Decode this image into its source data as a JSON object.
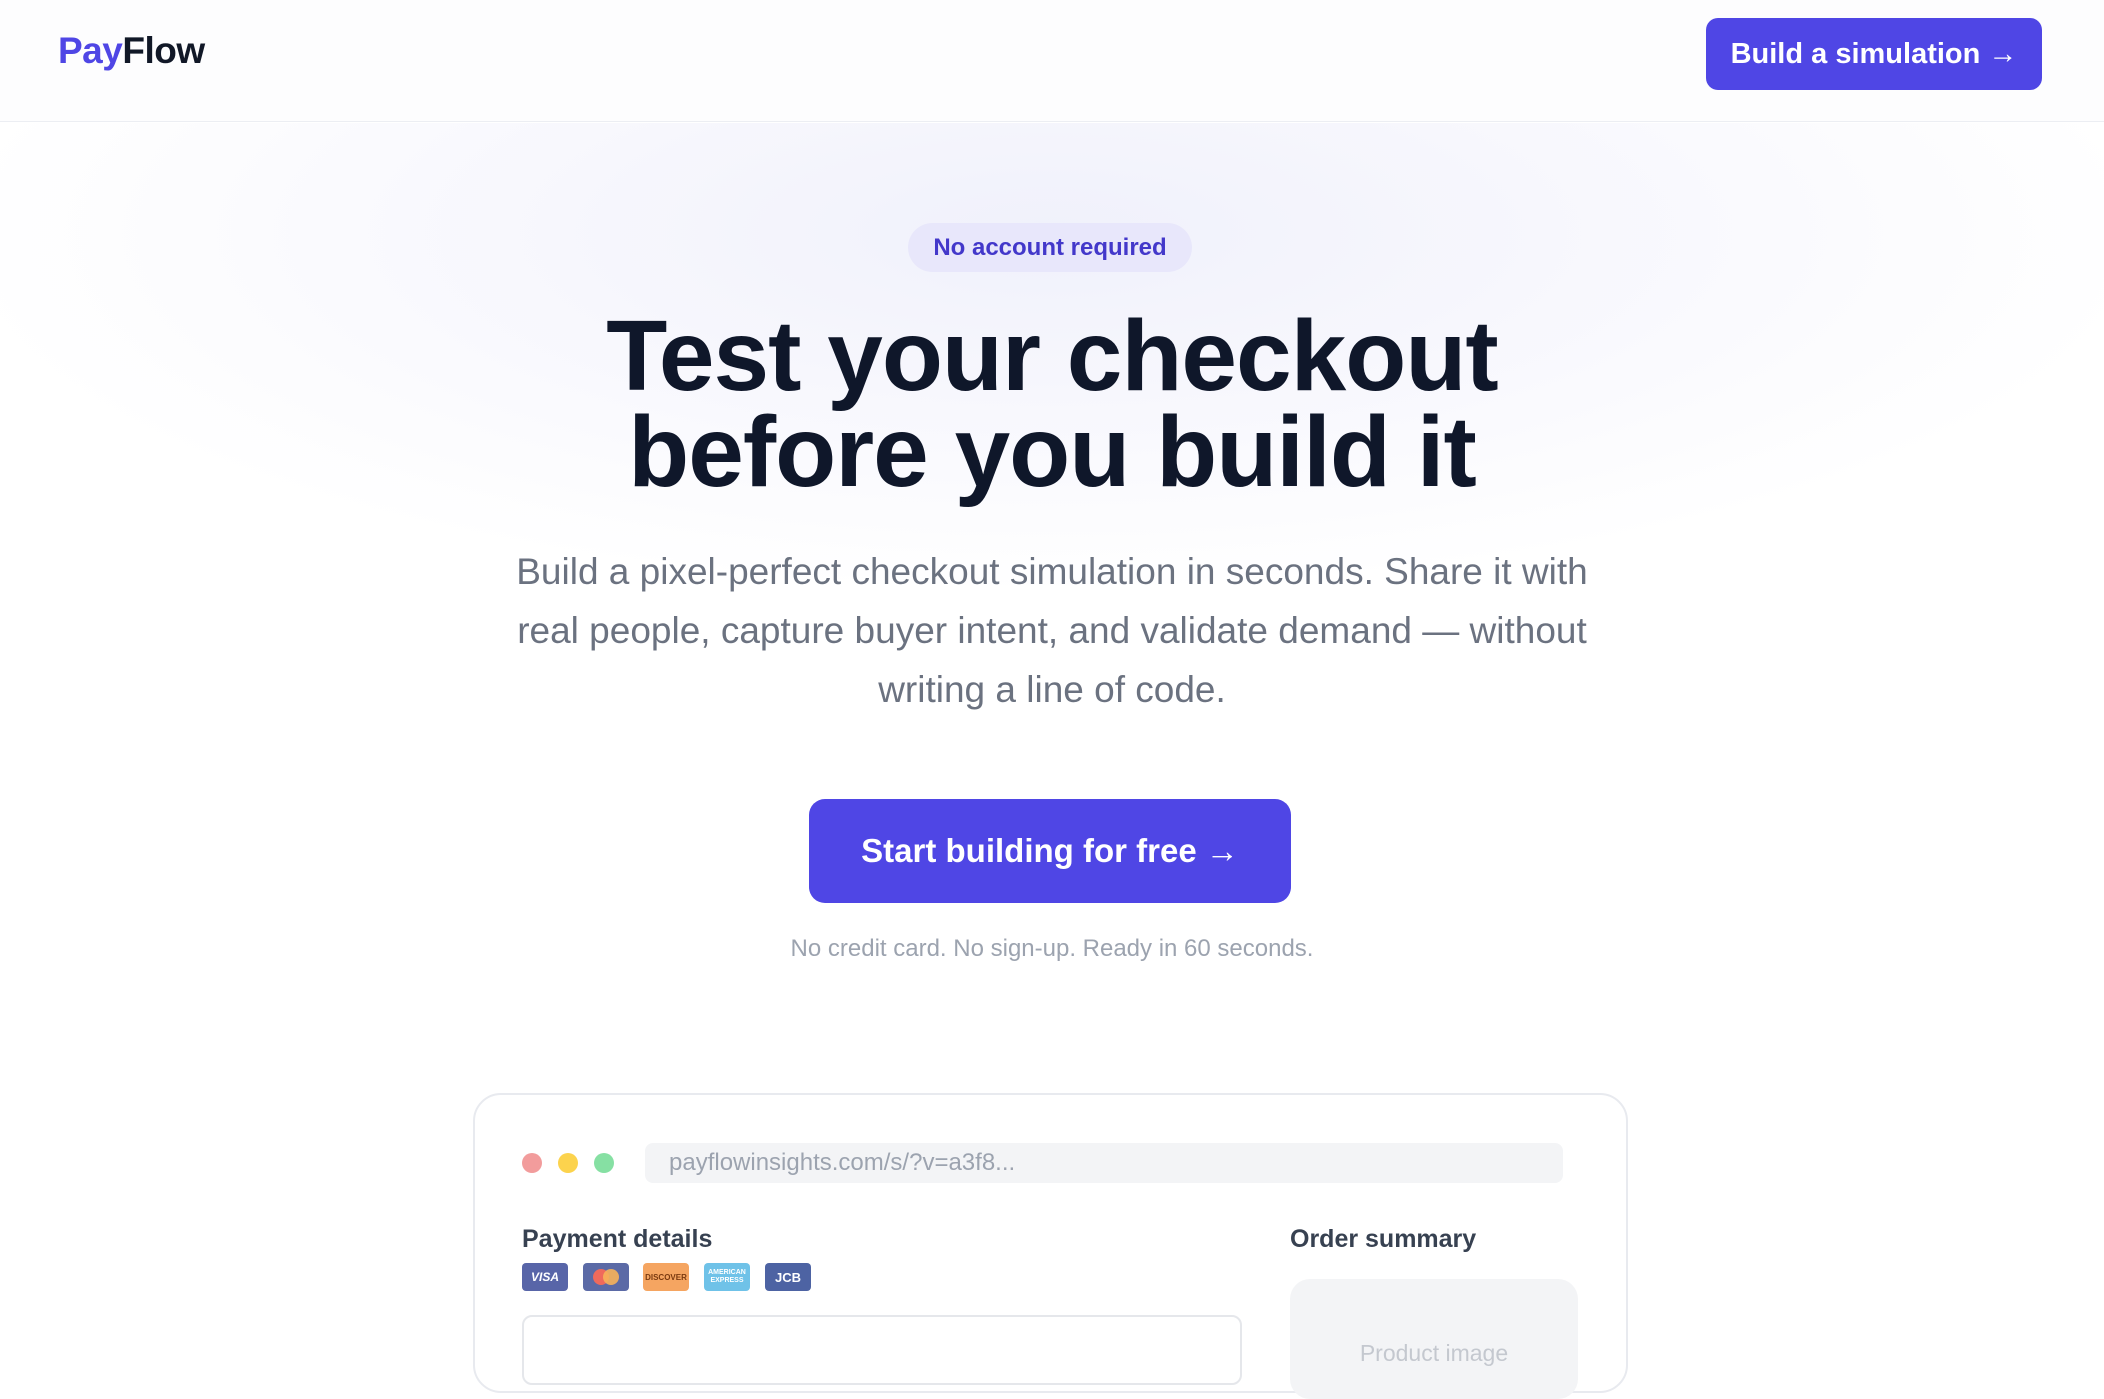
{
  "header": {
    "logo_part1": "Pay",
    "logo_part2": "Flow",
    "cta_label": "Build a simulation →"
  },
  "hero": {
    "badge": "No account required",
    "title_line1": "Test your checkout",
    "title_line2": "before you build it",
    "subtitle_line1": "Build a pixel-perfect checkout simulation in seconds. Share it with",
    "subtitle_line2": "real people, capture buyer intent, and validate demand — without",
    "subtitle_line3": "writing a line of code.",
    "cta_label": "Start building for free →",
    "note": "No credit card. No sign-up. Ready in 60 seconds."
  },
  "preview": {
    "url": "payflowinsights.com/s/?v=a3f8...",
    "payment_label": "Payment details",
    "order_label": "Order summary",
    "product_placeholder": "Product image",
    "card_brands": [
      "VISA",
      "Mastercard",
      "DISCOVER",
      "AMERICAN EXPRESS",
      "JCB"
    ]
  },
  "colors": {
    "accent": "#4f46e5",
    "text_dark": "#0f172a",
    "text_muted": "#6b7280"
  }
}
